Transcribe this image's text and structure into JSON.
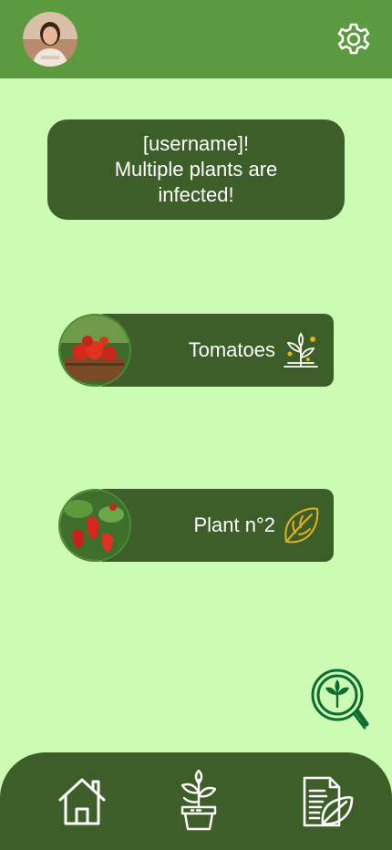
{
  "header": {
    "avatar": "user-avatar",
    "settings_icon": "gear-icon"
  },
  "alert": {
    "line1": "[username]!",
    "line2": "Multiple plants are",
    "line3": "infected!"
  },
  "plants": [
    {
      "name": "Tomatoes",
      "icon": "sprout-sun-icon"
    },
    {
      "name": "Plant n°2",
      "icon": "leaf-icon"
    }
  ],
  "scan_icon": "plant-search-icon",
  "nav": {
    "home_icon": "home-icon",
    "plants_icon": "potted-plant-icon",
    "reports_icon": "document-leaf-icon"
  },
  "colors": {
    "topbar": "#5c9a40",
    "background": "#ccfcb4",
    "card": "#3d5e28",
    "accent_gold": "#e0b21c",
    "scan_green": "#0e6b32"
  }
}
